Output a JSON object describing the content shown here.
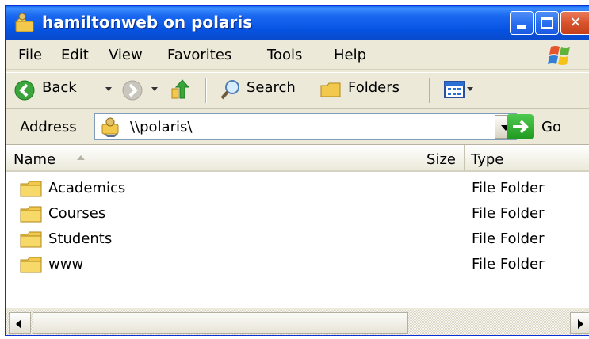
{
  "window": {
    "title": "hamiltonweb on polaris"
  },
  "titlebar_buttons": {
    "minimize": "minimize-button",
    "maximize": "maximize-button",
    "close": "close-button"
  },
  "menu": [
    {
      "label": "File"
    },
    {
      "label": "Edit"
    },
    {
      "label": "View"
    },
    {
      "label": "Favorites"
    },
    {
      "label": "Tools"
    },
    {
      "label": "Help"
    }
  ],
  "toolbar": {
    "back_label": "Back",
    "search_label": "Search",
    "folders_label": "Folders"
  },
  "address": {
    "label": "Address",
    "value": "\\\\polaris\\",
    "go_label": "Go"
  },
  "columns": {
    "name": "Name",
    "size": "Size",
    "type": "Type"
  },
  "items": [
    {
      "name": "Academics",
      "size": "",
      "type": "File Folder"
    },
    {
      "name": "Courses",
      "size": "",
      "type": "File Folder"
    },
    {
      "name": "Students",
      "size": "",
      "type": "File Folder"
    },
    {
      "name": "www",
      "size": "",
      "type": "File Folder"
    }
  ],
  "colors": {
    "titlebar": "#0553e1",
    "chrome": "#ece9d8",
    "close": "#d8532c",
    "go": "#2aa32a",
    "folder": "#e8b83a"
  }
}
